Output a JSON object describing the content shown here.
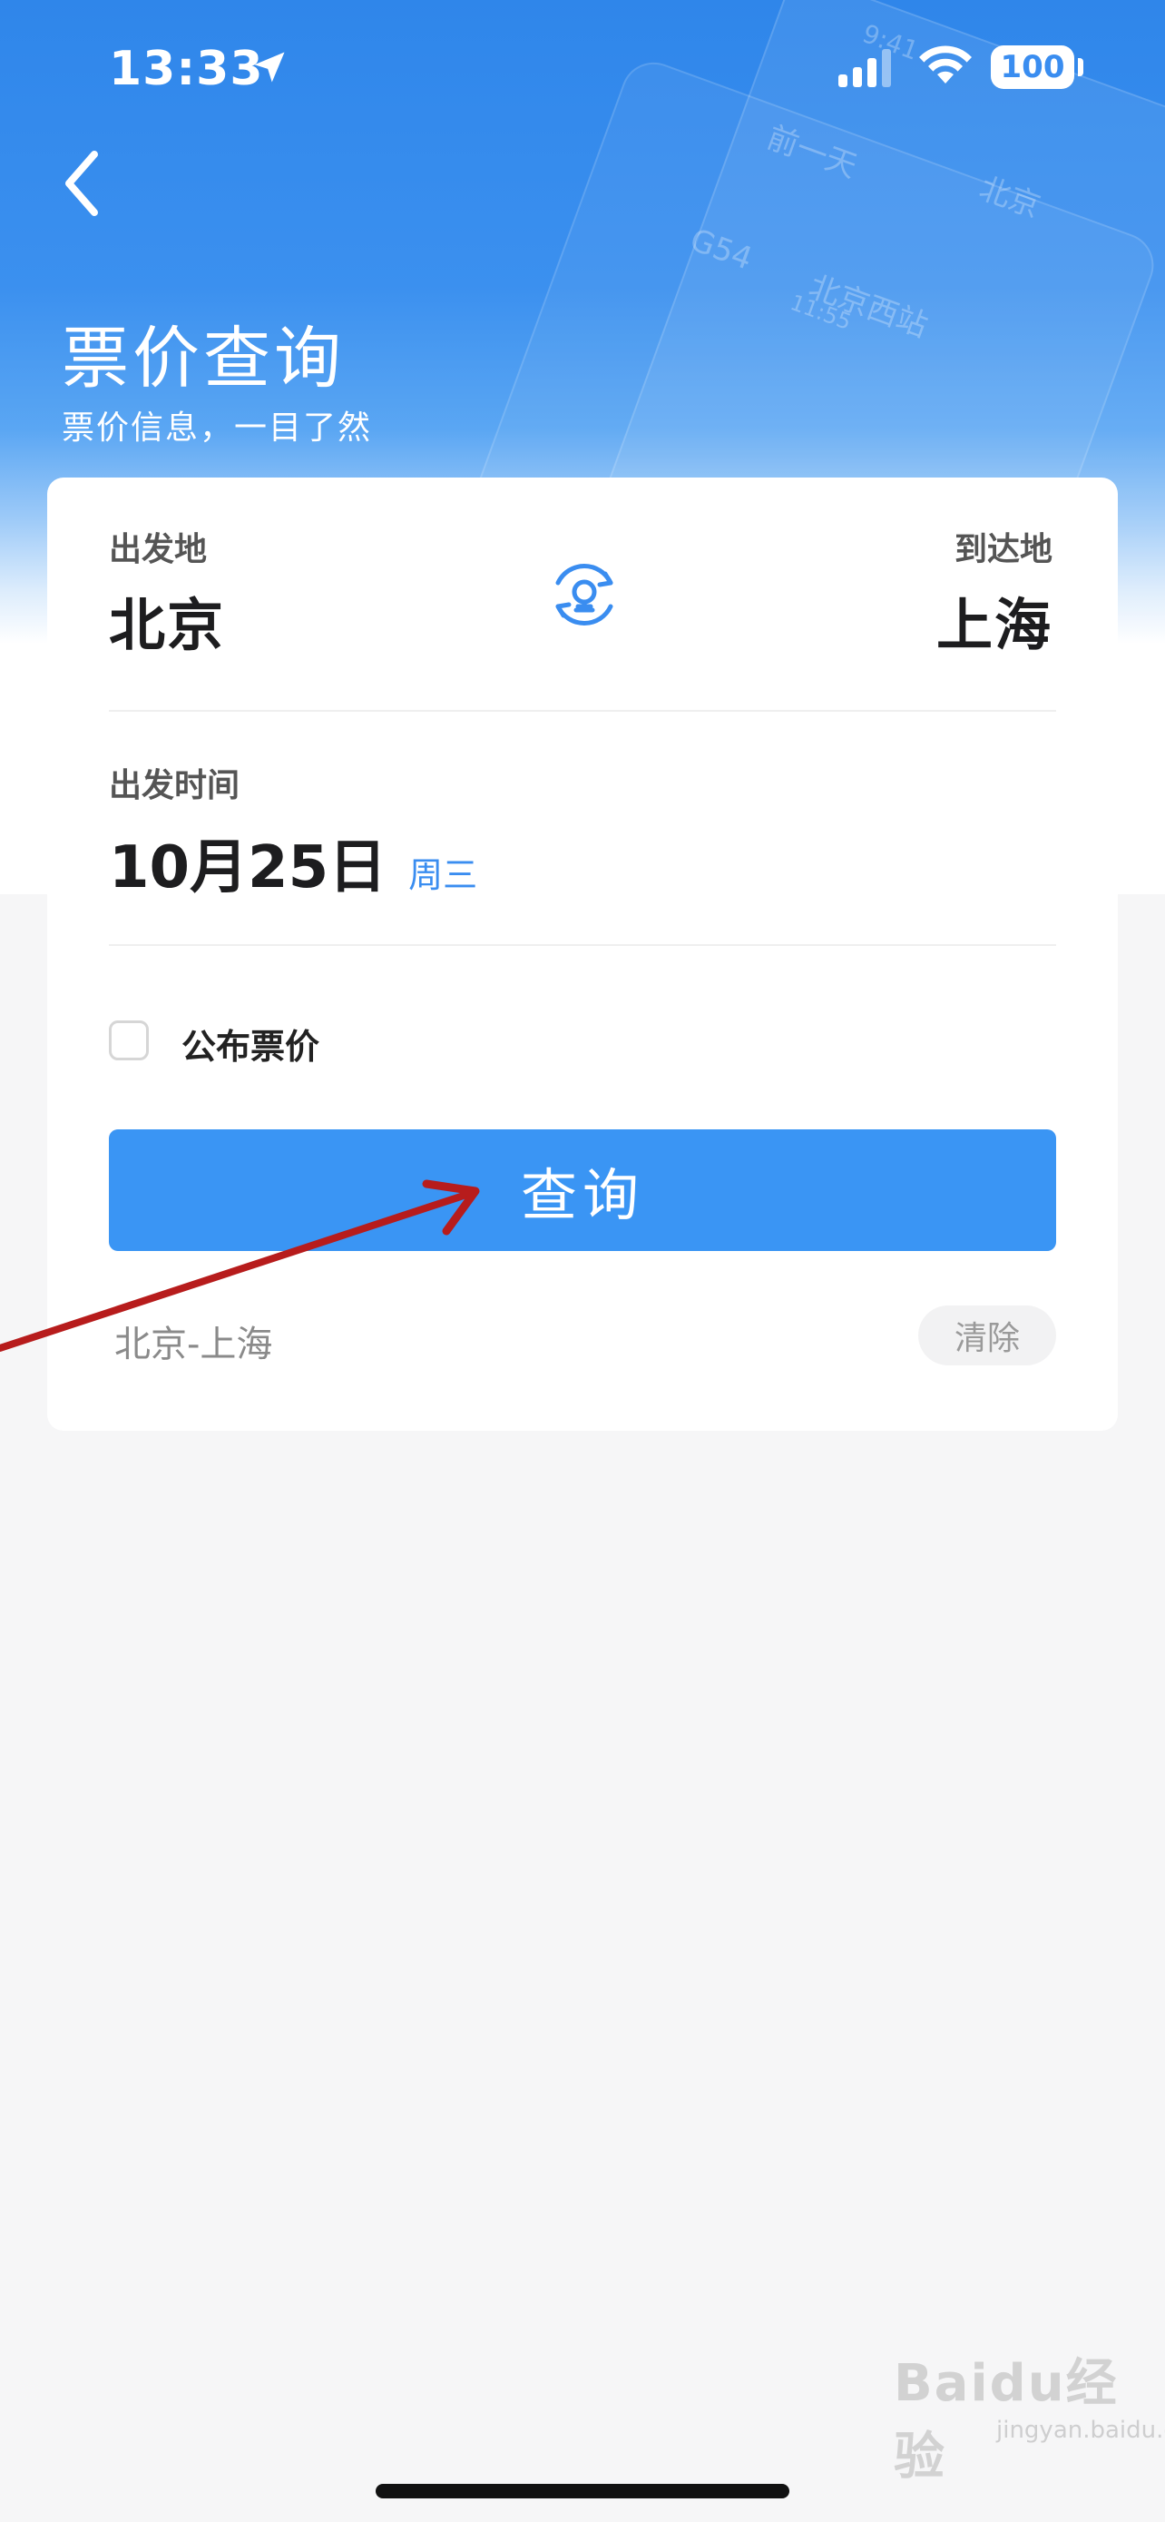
{
  "status_bar": {
    "time": "13:33",
    "battery": "100",
    "icons": [
      "location-arrow-icon",
      "cellular-signal-icon",
      "wifi-icon",
      "battery-icon"
    ]
  },
  "header": {
    "title": "票价查询",
    "subtitle": "票价信息，一目了然"
  },
  "form": {
    "from_label": "出发地",
    "from_city": "北京",
    "to_label": "到达地",
    "to_city": "上海",
    "swap_icon": "railway-swap-icon",
    "date_label": "出发时间",
    "date_value": "10月25日",
    "weekday": "周三",
    "checkbox_label": "公布票价",
    "checkbox_checked": false,
    "query_button": "查询"
  },
  "history": {
    "item": "北京-上海",
    "clear_button": "清除"
  },
  "background_ticket": {
    "prev_day": "前一天",
    "train": "G54",
    "station": "北京西站",
    "city": "北京",
    "time1": "9:41",
    "time2": "11:55"
  },
  "watermark": {
    "brand": "Baidu经验",
    "site": "jingyan.baidu.com"
  },
  "colors": {
    "accent": "#3a95f4",
    "header_blue": "#2f86ea",
    "annotation_arrow": "#b71c1c"
  }
}
